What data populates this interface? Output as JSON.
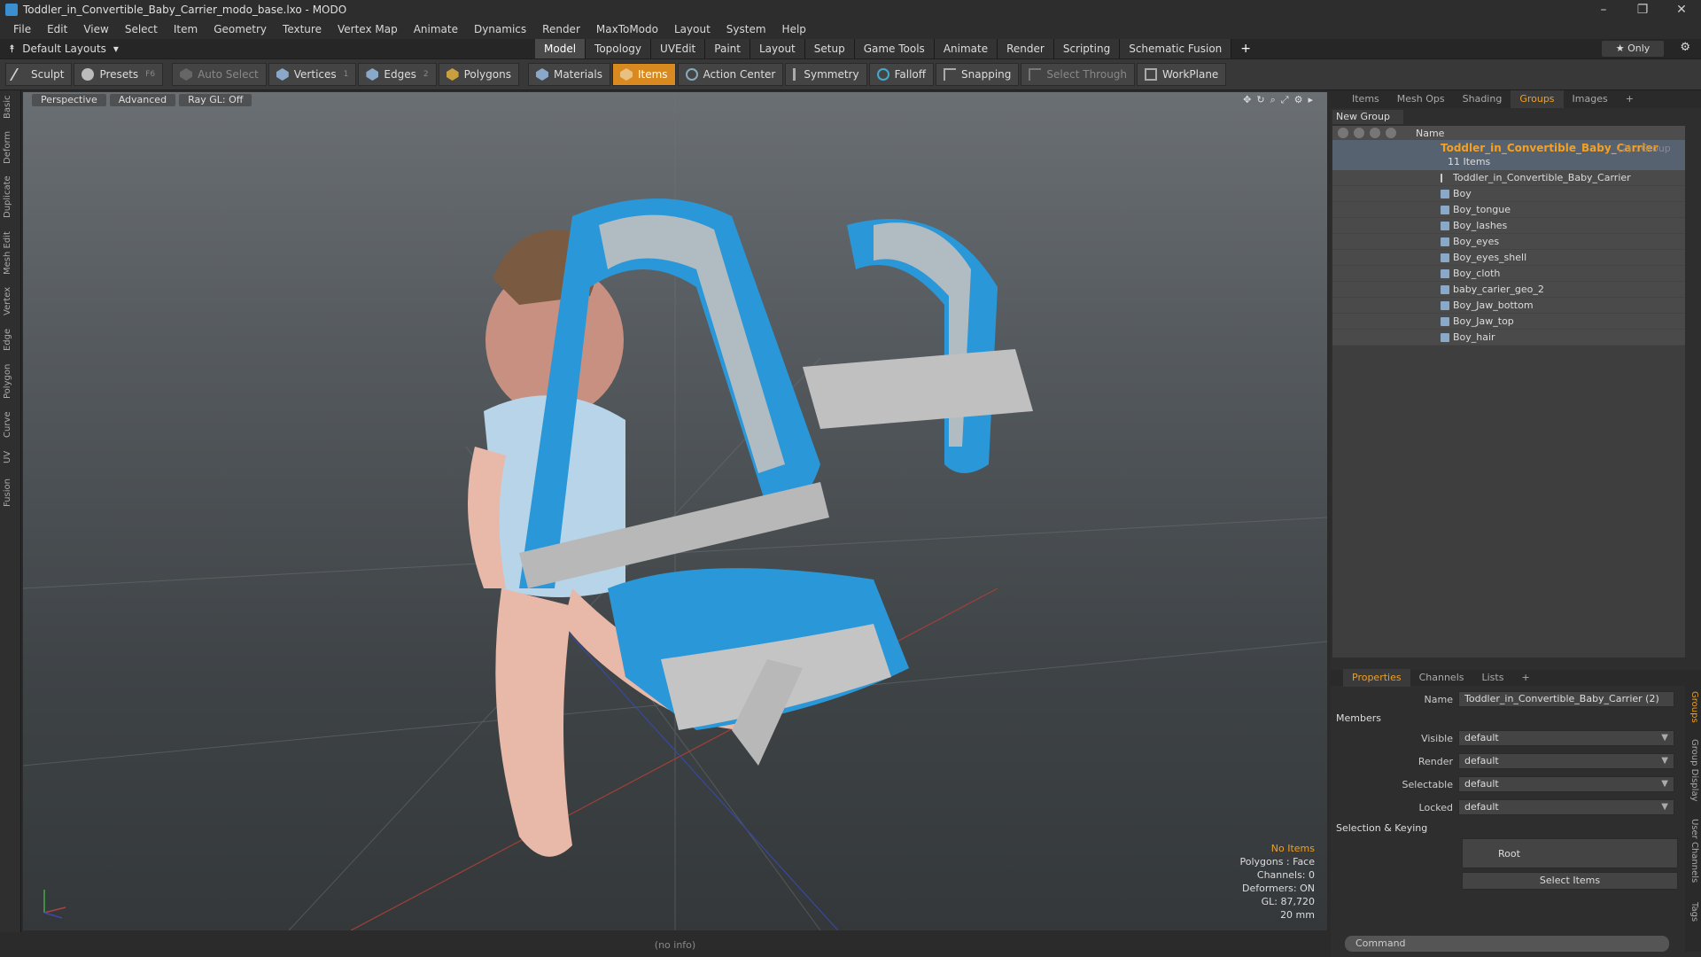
{
  "window": {
    "title": "Toddler_in_Convertible_Baby_Carrier_modo_base.lxo - MODO",
    "controls": [
      "–",
      "❐",
      "✕"
    ]
  },
  "menu": [
    "File",
    "Edit",
    "View",
    "Select",
    "Item",
    "Geometry",
    "Texture",
    "Vertex Map",
    "Animate",
    "Dynamics",
    "Render",
    "MaxToModo",
    "Layout",
    "System",
    "Help"
  ],
  "layout_selector": "Default Layouts",
  "mode_tabs": [
    "Model",
    "Topology",
    "UVEdit",
    "Paint",
    "Layout",
    "Setup",
    "Game Tools",
    "Animate",
    "Render",
    "Scripting",
    "Schematic Fusion"
  ],
  "active_mode": "Model",
  "only_label": "Only",
  "toolbar": {
    "sculpt": "Sculpt",
    "presets": "Presets",
    "presets_key": "F6",
    "auto_select": "Auto Select",
    "vertices": "Vertices",
    "vertices_key": "1",
    "edges": "Edges",
    "edges_key": "2",
    "polygons": "Polygons",
    "materials": "Materials",
    "items": "Items",
    "action_center": "Action Center",
    "symmetry": "Symmetry",
    "falloff": "Falloff",
    "snapping": "Snapping",
    "select_through": "Select Through",
    "workplane": "WorkPlane"
  },
  "left_tabs": [
    "Basic",
    "Deform",
    "Duplicate",
    "Mesh Edit",
    "Vertex",
    "Edge",
    "Polygon",
    "Curve",
    "UV",
    "Fusion"
  ],
  "viewport": {
    "perspective": "Perspective",
    "advanced": "Advanced",
    "raygl": "Ray GL: Off",
    "stats": {
      "no_items": "No Items",
      "polygons": "Polygons : Face",
      "channels": "Channels: 0",
      "deformers": "Deformers: ON",
      "gl": "GL: 87,720",
      "size": "20 mm"
    }
  },
  "status": "(no info)",
  "right_tabs": [
    "Items",
    "Mesh Ops",
    "Shading",
    "Groups",
    "Images"
  ],
  "active_right_tab": "Groups",
  "new_group": "New Group",
  "tree": {
    "name_header": "Name",
    "group_name": "Toddler_in_Convertible_Baby_Carrier",
    "group_suffix": "(2) : Group",
    "group_count": "11 Items",
    "items": [
      "Toddler_in_Convertible_Baby_Carrier",
      "Boy",
      "Boy_tongue",
      "Boy_lashes",
      "Boy_eyes",
      "Boy_eyes_shell",
      "Boy_cloth",
      "baby_carier_geo_2",
      "Boy_Jaw_bottom",
      "Boy_Jaw_top",
      "Boy_hair"
    ]
  },
  "props_tabs": [
    "Properties",
    "Channels",
    "Lists"
  ],
  "properties": {
    "name_label": "Name",
    "name_value": "Toddler_in_Convertible_Baby_Carrier (2)",
    "members": "Members",
    "visible_label": "Visible",
    "visible_value": "default",
    "render_label": "Render",
    "render_value": "default",
    "selectable_label": "Selectable",
    "selectable_value": "default",
    "locked_label": "Locked",
    "locked_value": "default",
    "selection_keying": "Selection & Keying",
    "root": "Root",
    "select_items": "Select Items"
  },
  "side_tabs": [
    "Groups",
    "Group Display",
    "User Channels",
    "Tags"
  ],
  "command_placeholder": "Command"
}
